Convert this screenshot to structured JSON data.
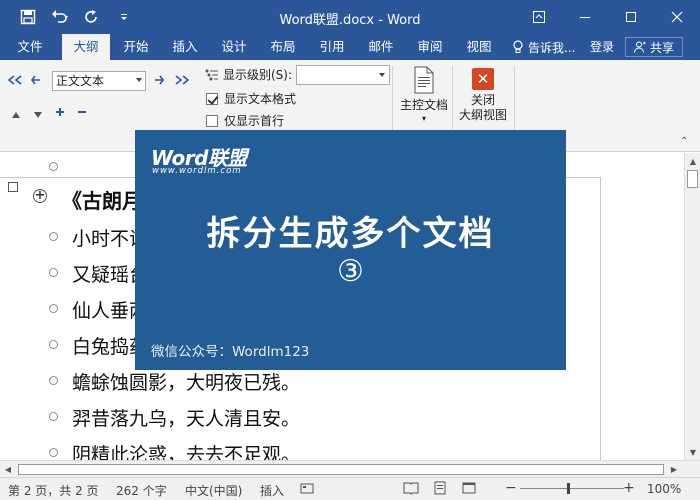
{
  "window": {
    "title": "Word联盟.docx - Word"
  },
  "tabs": [
    "文件",
    "大纲",
    "开始",
    "插入",
    "设计",
    "布局",
    "引用",
    "邮件",
    "审阅",
    "视图"
  ],
  "active_tab": "大纲",
  "tell_me": "告诉我...",
  "login": "登录",
  "share": "共享",
  "ribbon": {
    "outline_level": "正文文本",
    "show_level_label": "显示级别(S):",
    "show_format_label": "显示文本格式",
    "show_first_line_label": "仅显示首行",
    "show_format_checked": true,
    "show_first_line_checked": false,
    "master_doc_label": "主控文档",
    "close_outline_line1": "关闭",
    "close_outline_line2": "大纲视图"
  },
  "document": {
    "title_line": "《古朗月行》",
    "lines": [
      "小时不识月，呼作白玉盘。",
      "又疑瑶台镜，飞在青云端。",
      "仙人垂两足，桂树何团团。",
      "白兔捣药成，问言与谁餐。",
      "蟾蜍蚀圆影，大明夜已残。",
      "羿昔落九乌，天人清且安。",
      "阴精此沦惑，去去不足观。"
    ]
  },
  "overlay": {
    "logo": "Word联盟",
    "logo_url": "www.wordlm.com",
    "headline": "拆分生成多个文档",
    "number": "③",
    "wechat": "微信公众号：Wordlm123"
  },
  "status": {
    "page": "第 2 页，共 2 页",
    "words": "262 个字",
    "language": "中文(中国)",
    "mode": "插入",
    "zoom": "100%",
    "zoom_level": 0.5
  },
  "colors": {
    "brand": "#2b579a",
    "overlay": "#245c96",
    "close_button": "#d24726"
  }
}
